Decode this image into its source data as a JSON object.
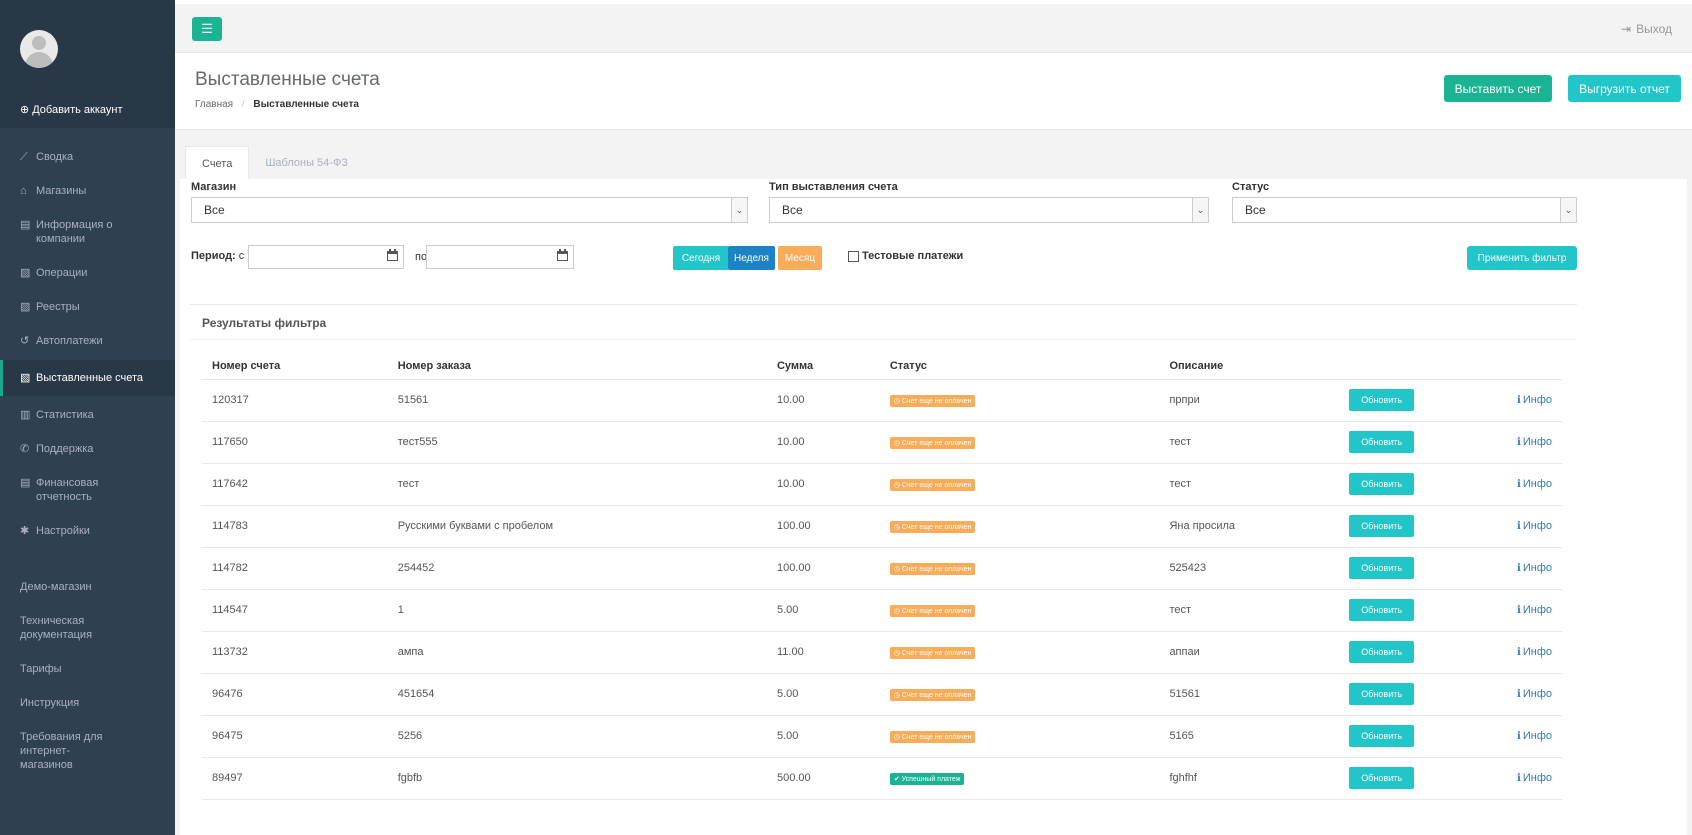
{
  "sidebar": {
    "add_account": "Добавить аккаунт",
    "items": [
      {
        "label": "Сводка",
        "icon": "chart-line-icon"
      },
      {
        "label": "Магазины",
        "icon": "bank-icon"
      },
      {
        "label": "Информация о компании",
        "icon": "file-icon"
      },
      {
        "label": "Операции",
        "icon": "copy-icon"
      },
      {
        "label": "Реестры",
        "icon": "copy-icon"
      },
      {
        "label": "Автоплатежи",
        "icon": "history-icon"
      },
      {
        "label": "Выставленные счета",
        "icon": "copy-icon"
      },
      {
        "label": "Статистика",
        "icon": "bar-chart-icon"
      },
      {
        "label": "Поддержка",
        "icon": "phone-icon"
      },
      {
        "label": "Финансовая отчетность",
        "icon": "file-icon"
      },
      {
        "label": "Настройки",
        "icon": "gear-icon"
      }
    ],
    "secondary": [
      "Демо-магазин",
      "Техническая документация",
      "Тарифы",
      "Инструкция",
      "Требования для интернет-магазинов"
    ]
  },
  "topbar": {
    "logout": "Выход"
  },
  "heading": {
    "title": "Выставленные счета",
    "breadcrumb_home": "Главная",
    "breadcrumb_current": "Выставленные счета",
    "invoice_button": "Выставить счет",
    "export_button": "Выгрузить отчет"
  },
  "tabs": [
    "Счета",
    "Шаблоны 54-ФЗ"
  ],
  "filters": {
    "shop_label": "Магазин",
    "shop_value": "Все",
    "type_label": "Тип выставления счета",
    "type_value": "Все",
    "status_label": "Статус",
    "status_value": "Все",
    "period_label": "Период:",
    "from_label": "с",
    "to_label": "по",
    "today": "Сегодня",
    "week": "Неделя",
    "month": "Месяц",
    "test_payments": "Тестовые платежи",
    "apply": "Применить фильтр"
  },
  "results": {
    "title": "Результаты фильтра",
    "columns": [
      "Номер счета",
      "Номер заказа",
      "Сумма",
      "Статус",
      "Описание"
    ],
    "refresh_label": "Обновить",
    "info_label": "Инфо",
    "rows": [
      {
        "invoice": "120317",
        "order": "51561",
        "sum": "10.00",
        "status": "Счет еще не оплачен",
        "status_type": "warn",
        "desc": "прпри"
      },
      {
        "invoice": "117650",
        "order": "тест555",
        "sum": "10.00",
        "status": "Счет еще не оплачен",
        "status_type": "warn",
        "desc": "тест"
      },
      {
        "invoice": "117642",
        "order": "тест",
        "sum": "10.00",
        "status": "Счет еще не оплачен",
        "status_type": "warn",
        "desc": "тест"
      },
      {
        "invoice": "114783",
        "order": "Русскими буквами с пробелом",
        "sum": "100.00",
        "status": "Счет еще не оплачен",
        "status_type": "warn",
        "desc": "Яна просила"
      },
      {
        "invoice": "114782",
        "order": "254452",
        "sum": "100.00",
        "status": "Счет еще не оплачен",
        "status_type": "warn",
        "desc": "525423"
      },
      {
        "invoice": "114547",
        "order": "1",
        "sum": "5.00",
        "status": "Счет еще не оплачен",
        "status_type": "warn",
        "desc": "тест"
      },
      {
        "invoice": "113732",
        "order": "ампа",
        "sum": "11.00",
        "status": "Счет еще не оплачен",
        "status_type": "warn",
        "desc": "аппаи"
      },
      {
        "invoice": "96476",
        "order": "451654",
        "sum": "5.00",
        "status": "Счет еще не оплачен",
        "status_type": "warn",
        "desc": "51561"
      },
      {
        "invoice": "96475",
        "order": "5256",
        "sum": "5.00",
        "status": "Счет еще не оплачен",
        "status_type": "warn",
        "desc": "5165"
      },
      {
        "invoice": "89497",
        "order": "fgbfb",
        "sum": "500.00",
        "status": "Успешный платеж",
        "status_type": "ok",
        "desc": "fghfhf"
      }
    ]
  },
  "colors": {
    "sidebar": "#2f4050",
    "primary": "#1ab394",
    "info": "#23c6c8",
    "warning": "#f8ac59",
    "week_button": "#1c84c6"
  }
}
